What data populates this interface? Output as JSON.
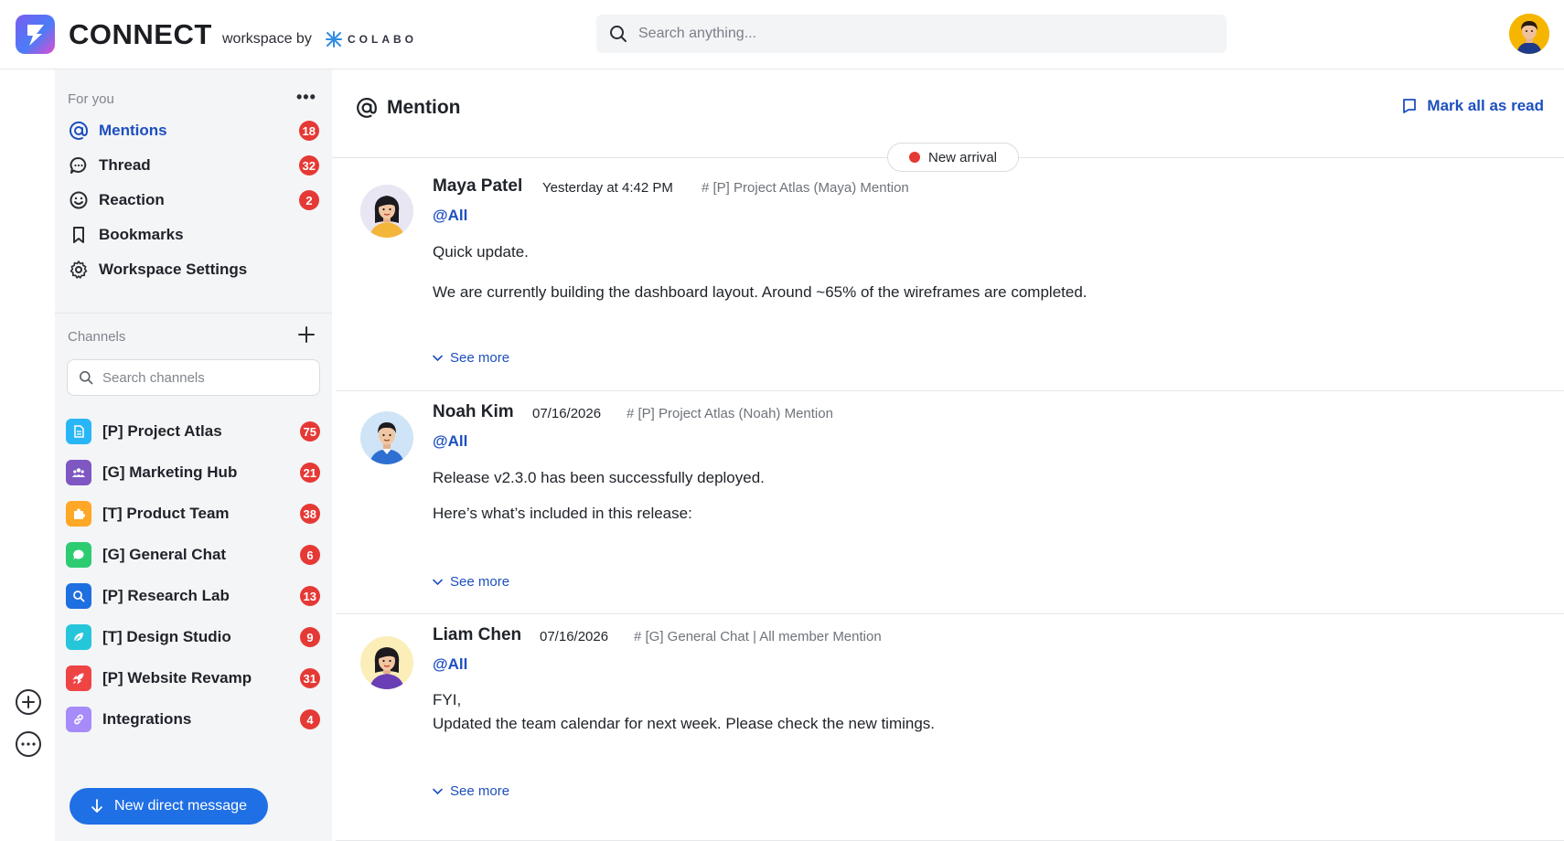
{
  "header": {
    "brand": "CONNECT",
    "brand_sub": "workspace by",
    "partner": "COLABO",
    "search_placeholder": "Search anything..."
  },
  "sidebar": {
    "for_you_label": "For you",
    "nav": [
      {
        "label": "Mentions",
        "icon": "at-icon",
        "badge": "18",
        "active": true
      },
      {
        "label": "Thread",
        "icon": "chat-bubble-icon",
        "badge": "32"
      },
      {
        "label": "Reaction",
        "icon": "smiley-icon",
        "badge": "2"
      },
      {
        "label": "Bookmarks",
        "icon": "bookmark-icon",
        "badge": ""
      },
      {
        "label": "Workspace Settings",
        "icon": "gear-icon",
        "badge": ""
      }
    ],
    "channels_label": "Channels",
    "channel_search_placeholder": "Search channels",
    "channels": [
      {
        "label": "[P] Project Atlas",
        "badge": "75",
        "color": "#29b6f6",
        "icon": "document-icon"
      },
      {
        "label": "[G] Marketing Hub",
        "badge": "21",
        "color": "#7e57c2",
        "icon": "people-icon"
      },
      {
        "label": "[T] Product Team",
        "badge": "38",
        "color": "#ffa726",
        "icon": "puzzle-icon"
      },
      {
        "label": "[G] General Chat",
        "badge": "6",
        "color": "#2ecc71",
        "icon": "chat-icon"
      },
      {
        "label": "[P] Research Lab",
        "badge": "13",
        "color": "#1e6fe0",
        "icon": "magnifier-icon"
      },
      {
        "label": "[T] Design Studio",
        "badge": "9",
        "color": "#26c6da",
        "icon": "leaf-icon"
      },
      {
        "label": "[P] Website Revamp",
        "badge": "31",
        "color": "#ef4444",
        "icon": "rocket-icon"
      },
      {
        "label": "Integrations",
        "badge": "4",
        "color": "#a78bfa",
        "icon": "link-icon"
      }
    ],
    "new_dm_label": "New direct message"
  },
  "main": {
    "title": "Mention",
    "mark_all_read": "Mark all as read",
    "new_arrival": "New arrival",
    "see_more": "See more",
    "messages": [
      {
        "author": "Maya Patel",
        "time": "Yesterday at 4:42 PM",
        "channel": "# [P] Project Atlas (Maya) Mention",
        "mention": "@All",
        "lines": [
          "Quick update.",
          "We are currently building the dashboard layout. Around ~65% of the wireframes are completed."
        ]
      },
      {
        "author": "Noah Kim",
        "time": "07/16/2026",
        "channel": "# [P] Project Atlas (Noah) Mention",
        "mention": "@All",
        "lines": [
          "Release v2.3.0 has been successfully deployed.",
          "Here’s what’s included in this release:"
        ]
      },
      {
        "author": "Liam Chen",
        "time": "07/16/2026",
        "channel": "# [G] General Chat | All member Mention",
        "mention": "@All",
        "lines": [
          "FYI,",
          "Updated the team calendar for next week. Please check the new timings."
        ]
      }
    ]
  },
  "colors": {
    "accent": "#1d4fbf",
    "badge": "#e53935",
    "primary_button": "#1f6fe5"
  }
}
